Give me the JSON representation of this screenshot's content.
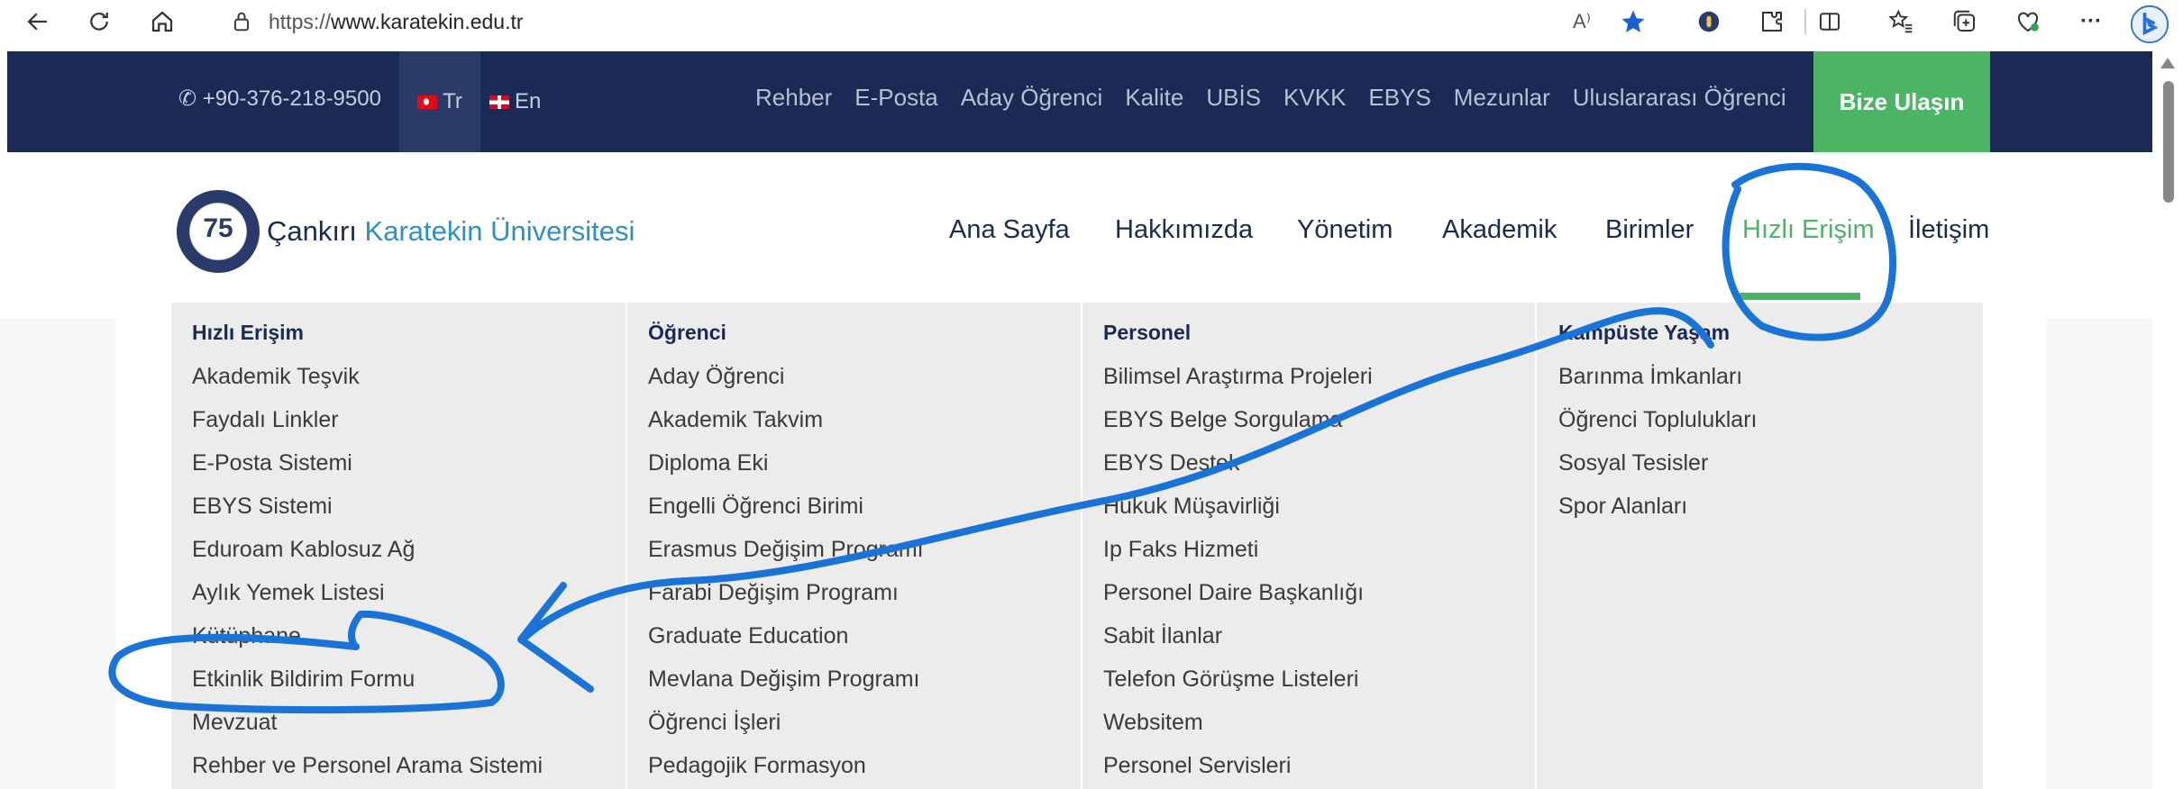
{
  "browser": {
    "url_prefix": "https://",
    "url_domain": "www.karatekin.edu.tr",
    "icons": [
      "back-icon",
      "refresh-icon",
      "home-icon",
      "lock-icon",
      "read-aloud-icon",
      "favorite-star-icon",
      "extension-icon",
      "puzzle-icon",
      "split-screen-icon",
      "favorites-icon",
      "collections-icon",
      "health-icon",
      "more-icon",
      "bing-icon"
    ],
    "read_aloud_label": "A⁾",
    "more_label": "···"
  },
  "topbar": {
    "phone": "+90-376-218-9500",
    "lang_tr": "Tr",
    "lang_en": "En",
    "links": [
      "Rehber",
      "E-Posta",
      "Aday Öğrenci",
      "Kalite",
      "UBİS",
      "KVKK",
      "EBYS",
      "Mezunlar",
      "Uluslararası Öğrenci"
    ],
    "contact_button": "Bize Ulaşın",
    "bg_color": "#1a2a55",
    "accent_color": "#4cb565"
  },
  "header": {
    "logo_badge": "75",
    "logo_name_part1": "Çankırı",
    "logo_name_part2": "Karatekin Üniversitesi",
    "nav": [
      "Ana Sayfa",
      "Hakkımızda",
      "Yönetim",
      "Akademik",
      "Birimler",
      "Hızlı Erişim",
      "İletişim"
    ],
    "active_nav": "Hızlı Erişim"
  },
  "mega_menu": {
    "columns": [
      {
        "title": "Hızlı Erişim",
        "items": [
          "Akademik Teşvik",
          "Faydalı Linkler",
          "E-Posta Sistemi",
          "EBYS Sistemi",
          "Eduroam Kablosuz Ağ",
          "Aylık Yemek Listesi",
          "Kütüphane",
          "Etkinlik Bildirim Formu",
          "Mevzuat",
          "Rehber ve Personel Arama Sistemi"
        ]
      },
      {
        "title": "Öğrenci",
        "items": [
          "Aday Öğrenci",
          "Akademik Takvim",
          "Diploma Eki",
          "Engelli Öğrenci Birimi",
          "Erasmus Değişim Programı",
          "Farabi Değişim Programı",
          "Graduate Education",
          "Mevlana Değişim Programı",
          "Öğrenci İşleri",
          "Pedagojik Formasyon"
        ]
      },
      {
        "title": "Personel",
        "items": [
          "Bilimsel Araştırma Projeleri",
          "EBYS Belge Sorgulama",
          "EBYS Destek",
          "Hukuk Müşavirliği",
          "Ip Faks Hizmeti",
          "Personel Daire Başkanlığı",
          "Sabit İlanlar",
          "Telefon Görüşme Listeleri",
          "Websitem",
          "Personel Servisleri"
        ]
      },
      {
        "title": "Kampüste Yaşam",
        "items": [
          "Barınma İmkanları",
          "Öğrenci Toplulukları",
          "Sosyal Tesisler",
          "Spor Alanları"
        ]
      }
    ]
  },
  "annotation": {
    "color": "#1a73d6"
  }
}
